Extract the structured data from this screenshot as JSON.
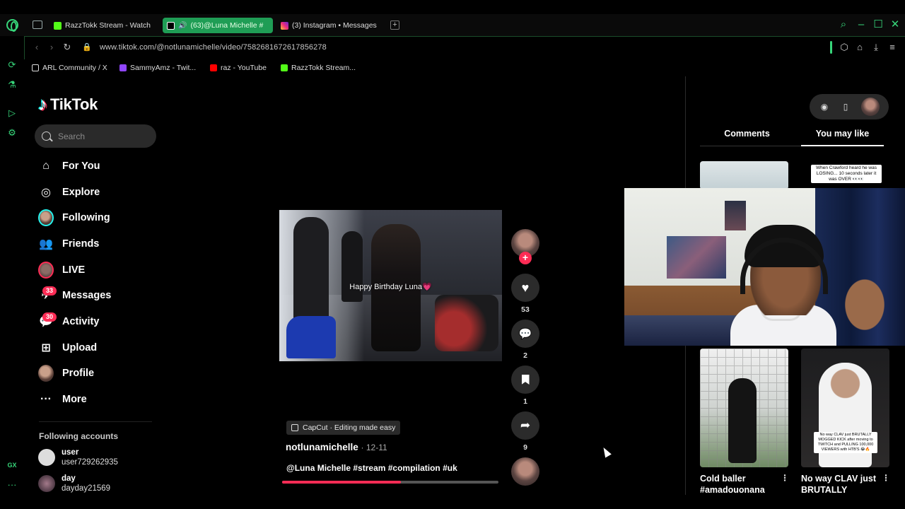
{
  "browser": {
    "tabs": [
      {
        "label": "RazzTokk Stream - Watch",
        "favicon_color": "#53fc18",
        "active": false
      },
      {
        "label": "(63)@Luna Michelle #",
        "favicon_color": "#000000",
        "active": true
      },
      {
        "label": "(3) Instagram • Messages",
        "favicon_color": "#e1306c",
        "active": false
      }
    ],
    "url": "www.tiktok.com/@notlunamichelle/video/7582681672617856278",
    "bookmarks": [
      {
        "label": "ARL Community / X",
        "favicon_color": "#ffffff"
      },
      {
        "label": "SammyAmz - Twit...",
        "favicon_color": "#9146ff"
      },
      {
        "label": "raz - YouTube",
        "favicon_color": "#ff0000"
      },
      {
        "label": "RazzTokk Stream...",
        "favicon_color": "#53fc18"
      }
    ],
    "sidebar_gx": "GX",
    "sidebar_more": "···",
    "accent_color": "#37d67a"
  },
  "tiktok": {
    "brand": "TikTok",
    "search_placeholder": "Search",
    "nav": [
      {
        "label": "For You",
        "icon": "home-icon"
      },
      {
        "label": "Explore",
        "icon": "compass-icon"
      },
      {
        "label": "Following",
        "icon": "avatar"
      },
      {
        "label": "Friends",
        "icon": "friends-icon"
      },
      {
        "label": "LIVE",
        "icon": "live-avatar"
      },
      {
        "label": "Messages",
        "icon": "messages-icon",
        "badge": "33"
      },
      {
        "label": "Activity",
        "icon": "activity-icon",
        "badge": "30"
      },
      {
        "label": "Upload",
        "icon": "upload-icon"
      },
      {
        "label": "Profile",
        "icon": "avatar"
      },
      {
        "label": "More",
        "icon": "more-icon"
      }
    ],
    "following_accounts_title": "Following accounts",
    "following_accounts": [
      {
        "display": "user",
        "handle": "user729262935"
      },
      {
        "display": "day",
        "handle": "dayday21569"
      }
    ]
  },
  "video": {
    "caption_overlay": "Happy Birthday Luna💗",
    "likes": "53",
    "comments": "2",
    "saves": "1",
    "shares": "9",
    "effect_label": "CapCut · Editing made easy",
    "author": "notlunamichelle",
    "date": "· 12-11",
    "description": "@Luna Michelle #stream #compilation #uk",
    "progress_fraction": 0.55
  },
  "right_panel": {
    "tabs": [
      "Comments",
      "You may like"
    ],
    "active_tab": "You may like",
    "thumb2_text": "When Crawford heard he was LOSING... 10 seconds later it was OVER 👀👀",
    "thumb4_text": "No way CLAV just BRUTALLY MOGGED KICK after moving to TWITCH and PULLING 100,000 VIEWERS with HTB'S 😂🔥",
    "rec_titles": [
      "Cold baller #amadouonana",
      "No way CLAV just BRUTALLY"
    ]
  }
}
